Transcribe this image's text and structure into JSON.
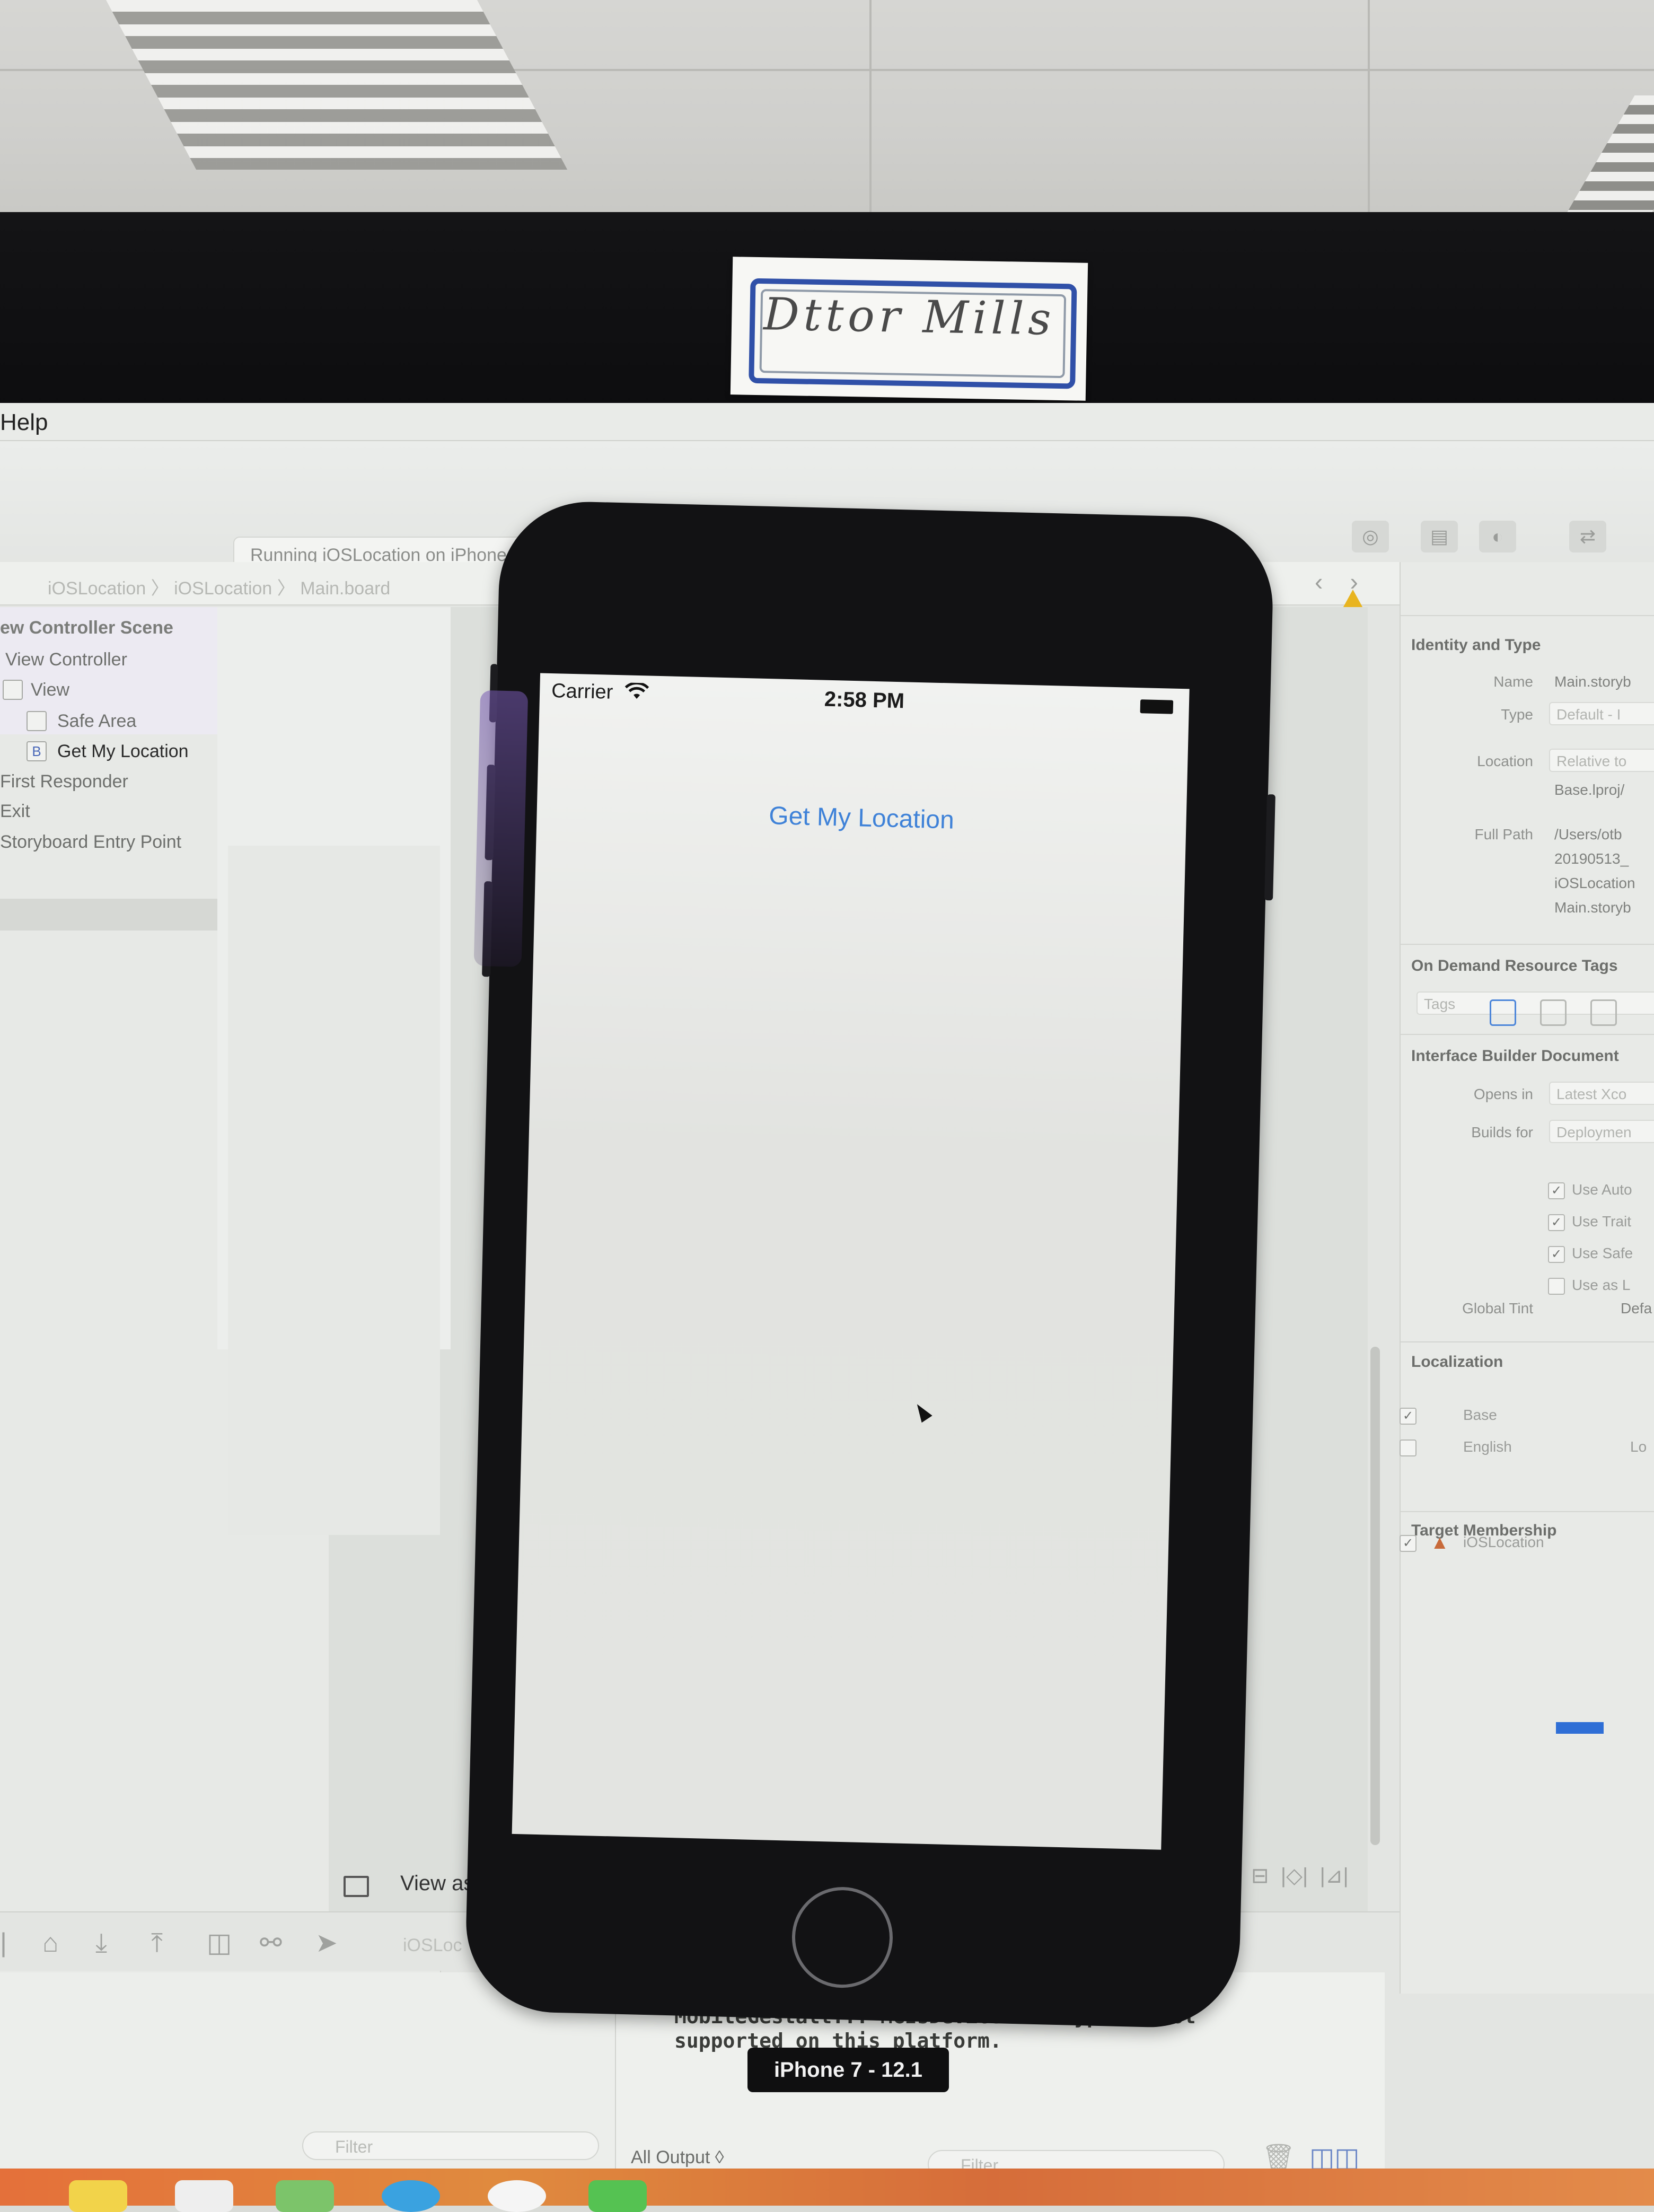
{
  "name_card": {
    "text": "Dttor  Mills"
  },
  "menubar": {
    "help": "Help"
  },
  "toolbar": {
    "activity_status": "Running iOSLocation on iPhone 7",
    "breadcrumb": "iOSLocation 〉 iOSLocation 〉 Main.board"
  },
  "outline": {
    "items": [
      {
        "label": "ew Controller Scene"
      },
      {
        "label": "View Controller"
      },
      {
        "label": "View"
      },
      {
        "label": "Safe Area"
      },
      {
        "label": "Get My Location",
        "icon_text": "B"
      },
      {
        "label": "First Responder"
      },
      {
        "label": "Exit"
      },
      {
        "label": "Storyboard Entry Point"
      }
    ]
  },
  "inspector": {
    "identity_title": "Identity and Type",
    "name_label": "Name",
    "name_value": "Main.storyb",
    "type_label": "Type",
    "type_value": "Default - I",
    "location_label": "Location",
    "location_value": "Relative to",
    "location_path": "Base.lproj/",
    "full_path_label": "Full Path",
    "full_path_lines": [
      "/Users/otb",
      "20190513_",
      "iOSLocation",
      "Main.storyb"
    ],
    "odr_title": "On Demand Resource Tags",
    "tags_placeholder": "Tags",
    "ib_title": "Interface Builder Document",
    "opens_in_label": "Opens in",
    "opens_in_value": "Latest Xco",
    "builds_for_label": "Builds for",
    "builds_for_value": "Deploymen",
    "checks": [
      {
        "label": "Use Auto",
        "checked": "✓"
      },
      {
        "label": "Use Trait",
        "checked": "✓"
      },
      {
        "label": "Use Safe",
        "checked": "✓"
      },
      {
        "label": "Use as L",
        "checked": ""
      }
    ],
    "global_tint_label": "Global Tint",
    "global_tint_value": "Defa",
    "localization_title": "Localization",
    "localizations": [
      {
        "label": "Base",
        "checked": "✓"
      },
      {
        "label": "English",
        "checked": "",
        "extra": "Lo"
      }
    ],
    "target_title": "Target Membership",
    "target_item": {
      "label": "iOSLocation",
      "checked": "✓"
    }
  },
  "canvas": {
    "view_as": "View as"
  },
  "debug": {
    "console_text": "MobileGestalt... MGIsDeviceOneOfType is not\nsupported on this platform.",
    "console_line1": "MobileGestaltSupport.m:153: pid 32022 (MobileGestalt",
    "filter_placeholder": "Filter",
    "all_output": "All Output ◊",
    "breadcrumb": "iOSLoc"
  },
  "simulator": {
    "carrier": "Carrier",
    "time": "2:58 PM",
    "button_label": "Get My Location",
    "device_label": "iPhone 7 - 12.1"
  },
  "colors": {
    "accent_blue": "#3f82d8",
    "warning": "#e8b420",
    "dock": "#e4703a"
  }
}
